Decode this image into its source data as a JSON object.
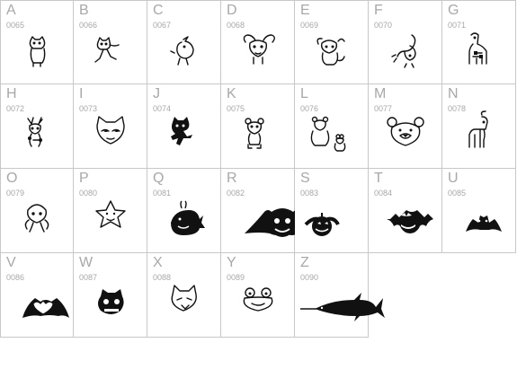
{
  "glyphs": [
    {
      "char": "A",
      "code": "0065",
      "icon": "cat-sitting-icon"
    },
    {
      "char": "B",
      "code": "0066",
      "icon": "cat-walking-icon"
    },
    {
      "char": "C",
      "code": "0067",
      "icon": "bird-icon"
    },
    {
      "char": "D",
      "code": "0068",
      "icon": "mouse-face-icon"
    },
    {
      "char": "E",
      "code": "0069",
      "icon": "mouse-sitting-icon"
    },
    {
      "char": "F",
      "code": "0070",
      "icon": "squirrel-icon"
    },
    {
      "char": "G",
      "code": "0071",
      "icon": "giraffe-icon"
    },
    {
      "char": "H",
      "code": "0072",
      "icon": "reindeer-icon"
    },
    {
      "char": "I",
      "code": "0073",
      "icon": "cat-mask-icon"
    },
    {
      "char": "J",
      "code": "0074",
      "icon": "black-cat-icon"
    },
    {
      "char": "K",
      "code": "0075",
      "icon": "teddy-bear-icon"
    },
    {
      "char": "L",
      "code": "0076",
      "icon": "bears-pair-icon"
    },
    {
      "char": "M",
      "code": "0077",
      "icon": "bear-face-icon"
    },
    {
      "char": "N",
      "code": "0078",
      "icon": "horse-icon"
    },
    {
      "char": "O",
      "code": "0079",
      "icon": "octopus-icon"
    },
    {
      "char": "P",
      "code": "0080",
      "icon": "star-face-icon"
    },
    {
      "char": "Q",
      "code": "0081",
      "icon": "whale-icon"
    },
    {
      "char": "R",
      "code": "0082",
      "icon": "bat-pumpkin-icon"
    },
    {
      "char": "S",
      "code": "0083",
      "icon": "pumpkin-icon"
    },
    {
      "char": "T",
      "code": "0084",
      "icon": "bat-grin-icon"
    },
    {
      "char": "U",
      "code": "0085",
      "icon": "bat-small-icon"
    },
    {
      "char": "V",
      "code": "0086",
      "icon": "bat-heart-icon"
    },
    {
      "char": "W",
      "code": "0087",
      "icon": "jack-o-lantern-icon"
    },
    {
      "char": "X",
      "code": "0088",
      "icon": "cat-grumpy-icon"
    },
    {
      "char": "Y",
      "code": "0089",
      "icon": "frog-face-icon"
    },
    {
      "char": "Z",
      "code": "0090",
      "icon": "marlin-fish-icon"
    }
  ]
}
